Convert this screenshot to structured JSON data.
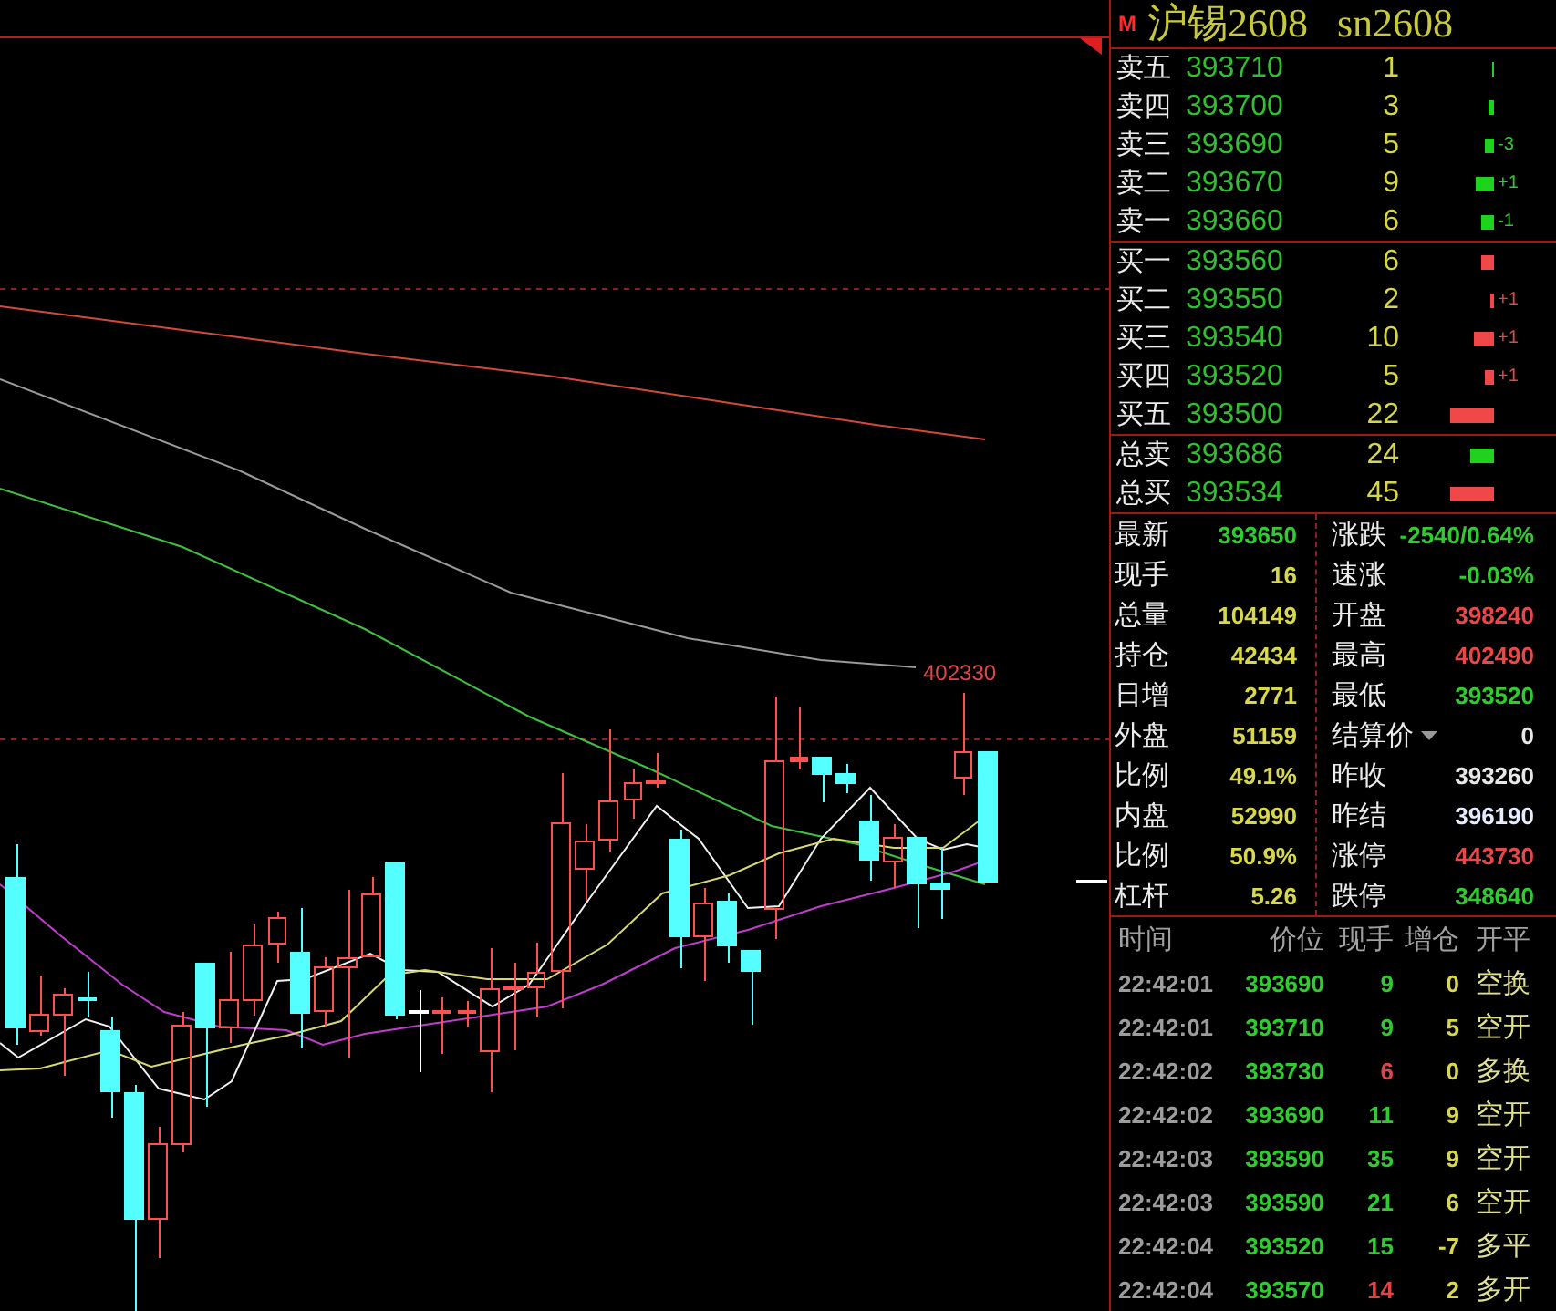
{
  "chart": {
    "price_label": "402330"
  },
  "instrument": {
    "badge": "M",
    "name": "沪锡2608",
    "code": "sn2608"
  },
  "order_book": {
    "asks": [
      {
        "label": "卖五",
        "price": "393710",
        "volume": "1"
      },
      {
        "label": "卖四",
        "price": "393700",
        "volume": "3"
      },
      {
        "label": "卖三",
        "price": "393690",
        "volume": "5",
        "change": "-3"
      },
      {
        "label": "卖二",
        "price": "393670",
        "volume": "9",
        "change": "+1"
      },
      {
        "label": "卖一",
        "price": "393660",
        "volume": "6",
        "change": "-1"
      }
    ],
    "bids": [
      {
        "label": "买一",
        "price": "393560",
        "volume": "6"
      },
      {
        "label": "买二",
        "price": "393550",
        "volume": "2",
        "change": "+1"
      },
      {
        "label": "买三",
        "price": "393540",
        "volume": "10",
        "change": "+1"
      },
      {
        "label": "买四",
        "price": "393520",
        "volume": "5",
        "change": "+1"
      },
      {
        "label": "买五",
        "price": "393500",
        "volume": "22"
      }
    ],
    "totals": [
      {
        "kind": "sell",
        "label": "总卖",
        "price": "393686",
        "volume": "24"
      },
      {
        "kind": "buy",
        "label": "总买",
        "price": "393534",
        "volume": "45"
      }
    ]
  },
  "quote": {
    "left": [
      {
        "label": "最新",
        "value": "393650",
        "color": "#2ecc2e"
      },
      {
        "label": "现手",
        "value": "16",
        "color": "#d8d84a"
      },
      {
        "label": "总量",
        "value": "104149",
        "color": "#d8d84a"
      },
      {
        "label": "持仓",
        "value": "42434",
        "color": "#d8d84a"
      },
      {
        "label": "日增",
        "value": "2771",
        "color": "#d8d84a"
      },
      {
        "label": "外盘",
        "value": "51159",
        "color": "#d8d84a"
      },
      {
        "label": "比例",
        "value": "49.1%",
        "color": "#d8d84a"
      },
      {
        "label": "内盘",
        "value": "52990",
        "color": "#d8d84a"
      },
      {
        "label": "比例",
        "value": "50.9%",
        "color": "#d8d84a"
      },
      {
        "label": "杠杆",
        "value": "5.26",
        "color": "#d8d84a"
      }
    ],
    "right": [
      {
        "label": "涨跌",
        "value": "-2540/0.64%",
        "color": "#2ecc2e",
        "dropdown": false
      },
      {
        "label": "速涨",
        "value": "-0.03%",
        "color": "#2ecc2e",
        "dropdown": false
      },
      {
        "label": "开盘",
        "value": "398240",
        "color": "#e84848",
        "dropdown": false
      },
      {
        "label": "最高",
        "value": "402490",
        "color": "#e84848",
        "dropdown": false
      },
      {
        "label": "最低",
        "value": "393520",
        "color": "#2ecc2e",
        "dropdown": false
      },
      {
        "label": "结算价",
        "value": "0",
        "color": "#e8e8e8",
        "dropdown": true
      },
      {
        "label": "昨收",
        "value": "393260",
        "color": "#e8e8e8",
        "dropdown": false
      },
      {
        "label": "昨结",
        "value": "396190",
        "color": "#e6ecff",
        "dropdown": false
      },
      {
        "label": "涨停",
        "value": "443730",
        "color": "#e84848",
        "dropdown": false
      },
      {
        "label": "跌停",
        "value": "348640",
        "color": "#2ecc2e",
        "dropdown": false
      }
    ]
  },
  "trades": {
    "columns": [
      "时间",
      "价位",
      "现手",
      "增仓",
      "开平"
    ],
    "rows": [
      {
        "time": "22:42:01",
        "price": "393690",
        "volume": "9",
        "color": "#2ecc2e",
        "change": "0",
        "type": "空换"
      },
      {
        "time": "22:42:01",
        "price": "393710",
        "volume": "9",
        "color": "#2ecc2e",
        "change": "5",
        "type": "空开"
      },
      {
        "time": "22:42:02",
        "price": "393730",
        "volume": "6",
        "color": "#e04444",
        "change": "0",
        "type": "多换"
      },
      {
        "time": "22:42:02",
        "price": "393690",
        "volume": "11",
        "color": "#2ecc2e",
        "change": "9",
        "type": "空开"
      },
      {
        "time": "22:42:03",
        "price": "393590",
        "volume": "35",
        "color": "#2ecc2e",
        "change": "9",
        "type": "空开"
      },
      {
        "time": "22:42:03",
        "price": "393590",
        "volume": "21",
        "color": "#2ecc2e",
        "change": "6",
        "type": "空开"
      },
      {
        "time": "22:42:04",
        "price": "393520",
        "volume": "15",
        "color": "#2ecc2e",
        "change": "-7",
        "type": "多平"
      },
      {
        "time": "22:42:04",
        "price": "393570",
        "volume": "14",
        "color": "#e04444",
        "change": "2",
        "type": "多开"
      }
    ]
  }
}
